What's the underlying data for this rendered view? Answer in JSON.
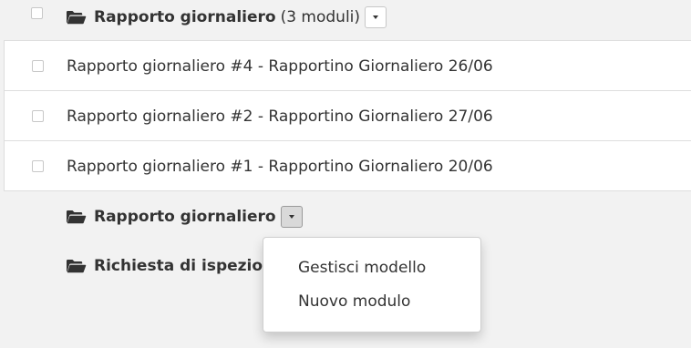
{
  "top_folder": {
    "label": "Rapporto giornaliero",
    "count": "(3 moduli)",
    "icon": "folder-open-icon"
  },
  "reports": [
    {
      "label": "Rapporto giornaliero #4 - Rapportino Giornaliero 26/06"
    },
    {
      "label": "Rapporto giornaliero #2 - Rapportino Giornaliero 27/06"
    },
    {
      "label": "Rapporto giornaliero #1 - Rapportino Giornaliero 20/06"
    }
  ],
  "subfolders": [
    {
      "label": "Rapporto giornaliero",
      "icon": "folder-open-icon"
    },
    {
      "label": "Richiesta di ispezione",
      "icon": "folder-open-icon"
    }
  ],
  "dropdown_menu": {
    "items": [
      {
        "label": "Gestisci modello"
      },
      {
        "label": "Nuovo modulo"
      }
    ]
  },
  "colors": {
    "background": "#f2f2f2",
    "text": "#333333",
    "border": "#dedede"
  }
}
